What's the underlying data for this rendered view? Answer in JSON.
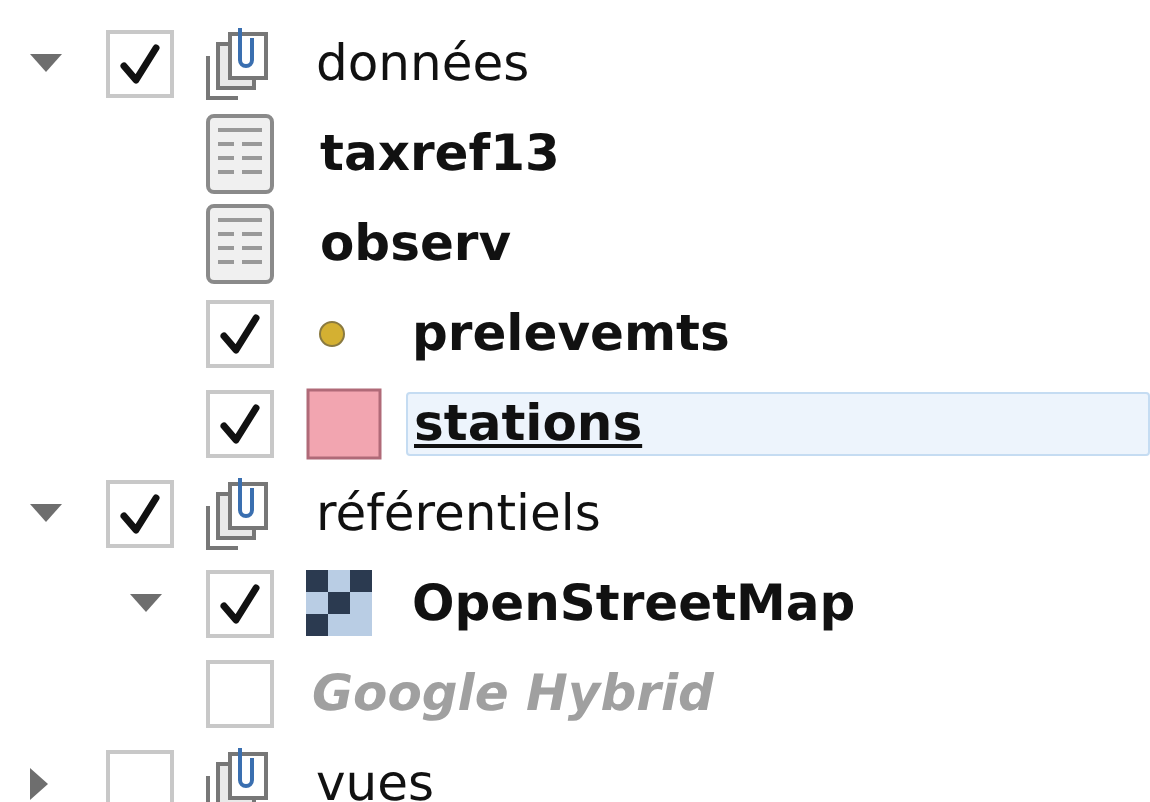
{
  "layers": [
    {
      "kind": "group",
      "label": "données",
      "checked": true,
      "expanded": true,
      "children": [
        {
          "kind": "table",
          "label": "taxref13",
          "selected": false
        },
        {
          "kind": "table",
          "label": "observ",
          "selected": false
        },
        {
          "kind": "point",
          "label": "prelevemts",
          "checked": true,
          "color": "#d4b032",
          "selected": false
        },
        {
          "kind": "polygon",
          "label": "stations",
          "checked": true,
          "color": "#f2a5b0",
          "selected": true
        }
      ]
    },
    {
      "kind": "group",
      "label": "référentiels",
      "checked": true,
      "expanded": true,
      "children": [
        {
          "kind": "raster",
          "label": "OpenStreetMap",
          "checked": true,
          "expanded": true,
          "selected": false
        },
        {
          "kind": "plain",
          "label": "Google Hybrid",
          "checked": false,
          "disabled": true,
          "selected": false
        }
      ]
    },
    {
      "kind": "group",
      "label": "vues",
      "checked": false,
      "expanded": false
    }
  ]
}
